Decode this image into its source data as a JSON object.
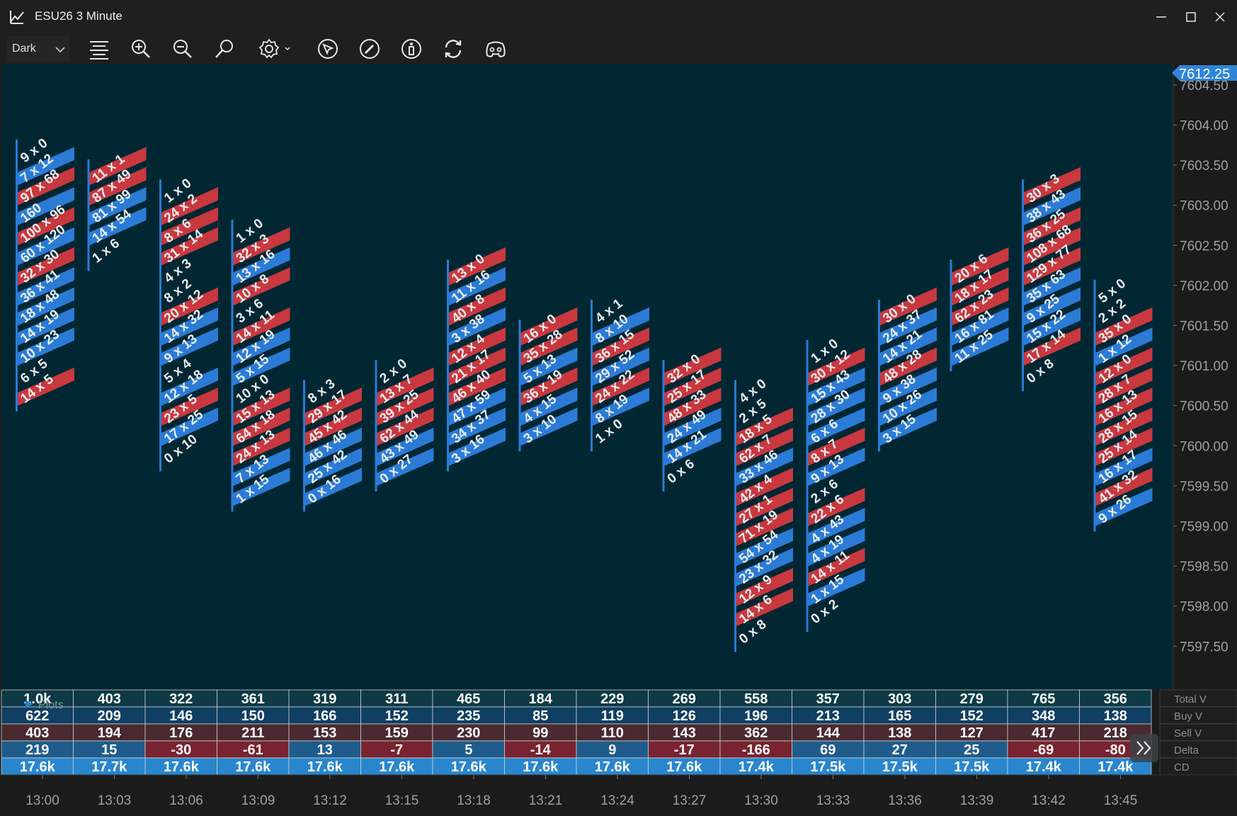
{
  "window": {
    "title": "ESU26 3 Minute",
    "minimize_icon": "minimize-icon",
    "maximize_icon": "maximize-icon",
    "close_icon": "close-icon"
  },
  "toolbar": {
    "theme_value": "Dark",
    "tools": [
      "menu-icon",
      "zoom-in-icon",
      "zoom-out-icon",
      "search-icon",
      "settings-icon",
      "cursor-icon",
      "draw-icon",
      "info-icon",
      "refresh-icon",
      "discord-icon"
    ]
  },
  "colors": {
    "chart_bg": "#012733",
    "bid_red": "#c9383f",
    "ask_blue": "#2b7bd6",
    "axis_bg": "#1b1b1b",
    "price_tag": "#2f86d8",
    "text": "#e9eef0"
  },
  "price_axis": {
    "current_price": "7612.25",
    "labels": [
      "7604.50",
      "7604.00",
      "7603.50",
      "7603.00",
      "7602.50",
      "7602.00",
      "7601.50",
      "7601.00",
      "7600.50",
      "7600.00",
      "7599.50",
      "7599.00",
      "7598.50",
      "7598.00",
      "7597.50"
    ]
  },
  "chart_data": {
    "type": "table",
    "instrument": "ESU26",
    "timeframe": "3 Minute",
    "tick_size": 0.25,
    "bars": [
      {
        "time": "13:00",
        "high": 7603.75,
        "levels": [
          "9 x 0",
          "7 x 12",
          "97 x 68",
          "160",
          "100 x 96",
          "60 x 120",
          "32 x 30",
          "36 x 41",
          "18 x 48",
          "14 x 19",
          "10 x 23",
          "6 x 5",
          "14 x 5"
        ]
      },
      {
        "time": "13:03",
        "high": 7603.5,
        "levels": [
          "11 x 1",
          "87 x 49",
          "81 x 99",
          "14 x 54",
          "1 x 6"
        ]
      },
      {
        "time": "13:06",
        "high": 7603.25,
        "levels": [
          "1 x 0",
          "24 x 2",
          "8 x 6",
          "31 x 14",
          "4 x 3",
          "8 x 2",
          "20 x 12",
          "14 x 32",
          "9 x 13",
          "5 x 4",
          "12 x 18",
          "23 x 5",
          "17 x 25",
          "0 x 10"
        ]
      },
      {
        "time": "13:09",
        "high": 7602.75,
        "levels": [
          "1 x 0",
          "32 x 3",
          "13 x 16",
          "10 x 8",
          "3 x 6",
          "14 x 11",
          "12 x 19",
          "5 x 15",
          "10 x 0",
          "15 x 13",
          "64 x 18",
          "24 x 13",
          "7 x 13",
          "1 x 15"
        ]
      },
      {
        "time": "13:12",
        "high": 7600.75,
        "levels": [
          "8 x 3",
          "29 x 17",
          "45 x 42",
          "46 x 46",
          "25 x 42",
          "0 x 16"
        ]
      },
      {
        "time": "13:15",
        "high": 7601.0,
        "levels": [
          "2 x 0",
          "13 x 7",
          "39 x 25",
          "62 x 44",
          "43 x 49",
          "0 x 27"
        ]
      },
      {
        "time": "13:18",
        "high": 7602.25,
        "levels": [
          "13 x 0",
          "11 x 16",
          "40 x 8",
          "3 x 38",
          "12 x 4",
          "21 x 17",
          "46 x 40",
          "47 x 59",
          "34 x 37",
          "3 x 16"
        ]
      },
      {
        "time": "13:21",
        "high": 7601.5,
        "levels": [
          "16 x 0",
          "35 x 28",
          "5 x 13",
          "36 x 19",
          "4 x 15",
          "3 x 10"
        ]
      },
      {
        "time": "13:24",
        "high": 7601.75,
        "levels": [
          "4 x 1",
          "8 x 10",
          "36 x 15",
          "29 x 52",
          "24 x 22",
          "8 x 19",
          "1 x 0"
        ]
      },
      {
        "time": "13:27",
        "high": 7601.0,
        "levels": [
          "32 x 0",
          "25 x 17",
          "48 x 33",
          "24 x 49",
          "14 x 21",
          "0 x 6"
        ]
      },
      {
        "time": "13:30",
        "high": 7600.75,
        "levels": [
          "4 x 0",
          "2 x 5",
          "18 x 5",
          "62 x 7",
          "33 x 46",
          "42 x 4",
          "27 x 1",
          "71 x 19",
          "54 x 54",
          "23 x 32",
          "12 x 9",
          "14 x 6",
          "0 x 8"
        ]
      },
      {
        "time": "13:33",
        "high": 7601.25,
        "levels": [
          "1 x 0",
          "30 x 12",
          "15 x 43",
          "28 x 30",
          "6 x 6",
          "8 x 7",
          "9 x 13",
          "2 x 6",
          "22 x 6",
          "4 x 43",
          "4 x 19",
          "14 x 11",
          "1 x 15",
          "0 x 2"
        ]
      },
      {
        "time": "13:36",
        "high": 7601.75,
        "levels": [
          "30 x 0",
          "24 x 37",
          "14 x 21",
          "48 x 28",
          "9 x 38",
          "10 x 26",
          "3 x 15"
        ]
      },
      {
        "time": "13:39",
        "high": 7602.25,
        "levels": [
          "20 x 6",
          "18 x 17",
          "62 x 23",
          "16 x 81",
          "11 x 25"
        ]
      },
      {
        "time": "13:42",
        "high": 7603.25,
        "levels": [
          "30 x 3",
          "38 x 43",
          "36 x 25",
          "108 x 68",
          "129 x 77",
          "35 x 63",
          "9 x 25",
          "15 x 22",
          "17 x 14",
          "0 x 8"
        ]
      },
      {
        "time": "13:45",
        "high": 7602.0,
        "levels": [
          "5 x 0",
          "2 x 2",
          "35 x 0",
          "1 x 12",
          "12 x 0",
          "28 x 7",
          "16 x 13",
          "28 x 15",
          "25 x 14",
          "16 x 17",
          "41 x 32",
          "9 x 26"
        ]
      }
    ]
  },
  "stats_table": {
    "overlay_label": "Plots",
    "row_labels": [
      "Total V",
      "Buy V",
      "Sell V",
      "Delta",
      "CD"
    ],
    "total_v": [
      "1.0k",
      "403",
      "322",
      "361",
      "319",
      "311",
      "465",
      "184",
      "229",
      "269",
      "558",
      "357",
      "303",
      "279",
      "765",
      "356"
    ],
    "buy_v": [
      "622",
      "209",
      "146",
      "150",
      "166",
      "152",
      "235",
      "85",
      "119",
      "126",
      "196",
      "213",
      "165",
      "152",
      "348",
      "138"
    ],
    "sell_v": [
      "403",
      "194",
      "176",
      "211",
      "153",
      "159",
      "230",
      "99",
      "110",
      "143",
      "362",
      "144",
      "138",
      "127",
      "417",
      "218"
    ],
    "delta": [
      "219",
      "15",
      "-30",
      "-61",
      "13",
      "-7",
      "5",
      "-14",
      "9",
      "-17",
      "-166",
      "69",
      "27",
      "25",
      "-69",
      "-80"
    ],
    "cd": [
      "17.6k",
      "17.7k",
      "17.6k",
      "17.6k",
      "17.6k",
      "17.6k",
      "17.6k",
      "17.6k",
      "17.6k",
      "17.6k",
      "17.4k",
      "17.5k",
      "17.5k",
      "17.5k",
      "17.4k",
      "17.4k"
    ],
    "scroll_icon": "double-chevron-right-icon"
  },
  "time_axis": {
    "labels": [
      "13:00",
      "13:03",
      "13:06",
      "13:09",
      "13:12",
      "13:15",
      "13:18",
      "13:21",
      "13:24",
      "13:27",
      "13:30",
      "13:33",
      "13:36",
      "13:39",
      "13:42",
      "13:45"
    ]
  }
}
